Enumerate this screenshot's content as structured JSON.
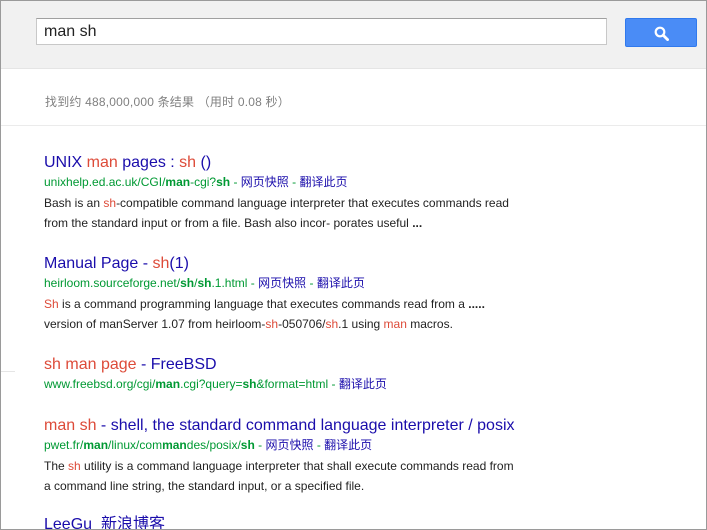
{
  "search": {
    "query": "man sh"
  },
  "stats": "找到约 488,000,000 条结果 （用时 0.08 秒）",
  "common": {
    "cache": "网页快照",
    "translate": "翻译此页",
    "sep": " - "
  },
  "results": [
    {
      "title": [
        {
          "t": "UNIX "
        },
        {
          "t": "man",
          "em": true
        },
        {
          "t": " pages : "
        },
        {
          "t": "sh",
          "em": true
        },
        {
          "t": " ()"
        }
      ],
      "url": [
        {
          "t": "unixhelp.ed.ac.uk/CGI/"
        },
        {
          "t": "man",
          "b": true
        },
        {
          "t": "-cgi?"
        },
        {
          "t": "sh",
          "b": true
        }
      ],
      "cache": true,
      "translate": true,
      "snippet": [
        [
          {
            "t": "Bash is an "
          },
          {
            "t": "sh",
            "em": true
          },
          {
            "t": "-compatible command language interpreter that executes commands read"
          }
        ],
        [
          {
            "t": "from the standard input or from a file. Bash also incor- porates useful "
          },
          {
            "t": "...",
            "b": true
          }
        ]
      ]
    },
    {
      "title": [
        {
          "t": "Manual Page - "
        },
        {
          "t": "sh",
          "em": true
        },
        {
          "t": "(1)"
        }
      ],
      "url": [
        {
          "t": "heirloom.sourceforge.net/"
        },
        {
          "t": "sh",
          "b": true
        },
        {
          "t": "/"
        },
        {
          "t": "sh",
          "b": true
        },
        {
          "t": ".1.html"
        }
      ],
      "cache": true,
      "translate": true,
      "snippet": [
        [
          {
            "t": "Sh",
            "em": true
          },
          {
            "t": " is a command programming language that executes commands read from a "
          },
          {
            "t": ".....",
            "b": true
          }
        ],
        [
          {
            "t": "version of manServer 1.07 from heirloom-"
          },
          {
            "t": "sh",
            "em": true
          },
          {
            "t": "-050706/"
          },
          {
            "t": "sh",
            "em": true
          },
          {
            "t": ".1 using "
          },
          {
            "t": "man",
            "em": true
          },
          {
            "t": " macros."
          }
        ]
      ]
    },
    {
      "title": [
        {
          "t": "sh",
          "em": true
        },
        {
          "t": " "
        },
        {
          "t": "man",
          "em": true
        },
        {
          "t": " "
        },
        {
          "t": "page",
          "em": true
        },
        {
          "t": " - FreeBSD"
        }
      ],
      "url": [
        {
          "t": "www.freebsd.org/cgi/"
        },
        {
          "t": "man",
          "b": true
        },
        {
          "t": ".cgi?query="
        },
        {
          "t": "sh",
          "b": true
        },
        {
          "t": "&format=html"
        }
      ],
      "cache": false,
      "translate": true,
      "snippet": []
    },
    {
      "title": [
        {
          "t": "man",
          "em": true
        },
        {
          "t": " "
        },
        {
          "t": "sh",
          "em": true
        },
        {
          "t": " - shell, the standard command language interpreter / posix"
        }
      ],
      "url": [
        {
          "t": "pwet.fr/"
        },
        {
          "t": "man",
          "b": true
        },
        {
          "t": "/linux/com"
        },
        {
          "t": "man",
          "b": true
        },
        {
          "t": "des/posix/"
        },
        {
          "t": "sh",
          "b": true
        }
      ],
      "cache": true,
      "translate": true,
      "snippet": [
        [
          {
            "t": "The "
          },
          {
            "t": "sh",
            "em": true
          },
          {
            "t": " utility is a command language interpreter that shall execute commands read from"
          }
        ],
        [
          {
            "t": "a command line string, the standard input, or a specified file."
          }
        ]
      ]
    },
    {
      "title": [
        {
          "t": "LeeGu_新浪博客"
        }
      ],
      "url": [],
      "cache": false,
      "translate": false,
      "snippet": []
    }
  ]
}
